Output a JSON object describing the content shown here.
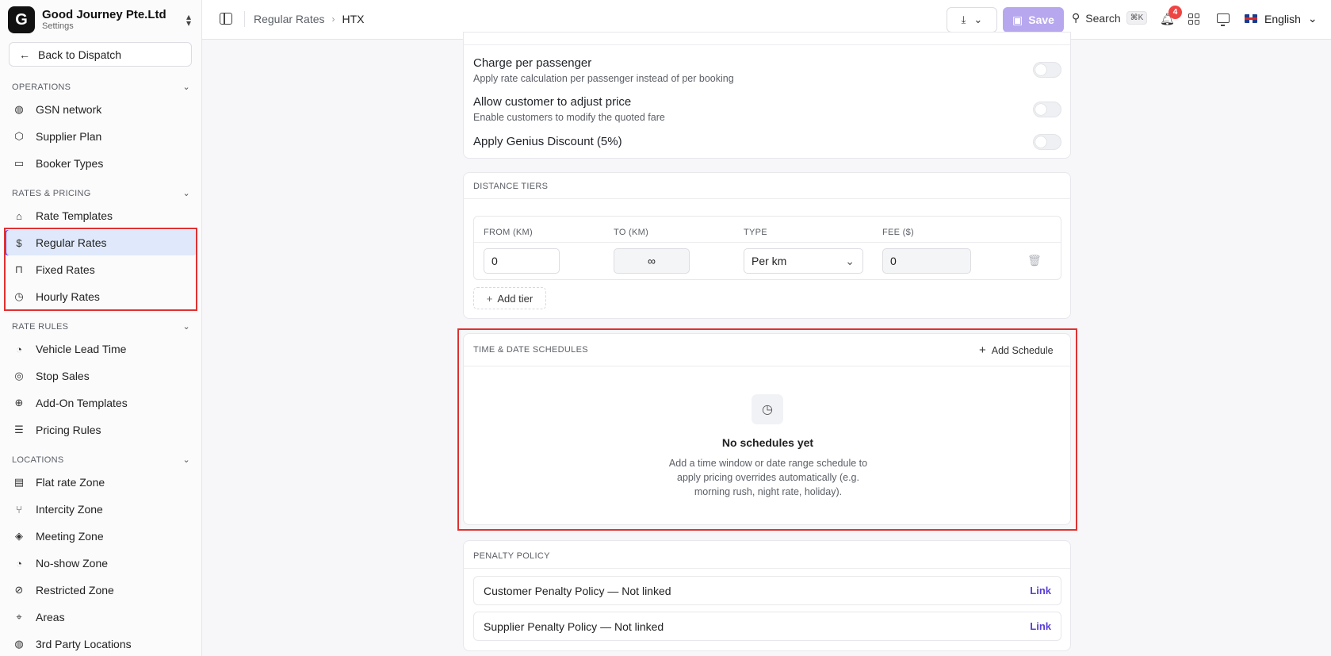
{
  "brand": {
    "name": "Good Journey Pte.Ltd",
    "subtitle": "Settings",
    "logo_letter": "G"
  },
  "back_button": "Back to Dispatch",
  "sidebar": {
    "sections": [
      {
        "title": "OPERATIONS",
        "items": [
          {
            "label": "GSN network",
            "icon": "globe-icon"
          },
          {
            "label": "Supplier Plan",
            "icon": "box-icon"
          },
          {
            "label": "Booker Types",
            "icon": "briefcase-icon"
          }
        ]
      },
      {
        "title": "RATES & PRICING",
        "items": [
          {
            "label": "Rate Templates",
            "icon": "tag-icon"
          },
          {
            "label": "Regular Rates",
            "icon": "dollar-icon",
            "active": true
          },
          {
            "label": "Fixed Rates",
            "icon": "lock-icon"
          },
          {
            "label": "Hourly Rates",
            "icon": "clock-icon"
          }
        ]
      },
      {
        "title": "RATE RULES",
        "items": [
          {
            "label": "Vehicle Lead Time",
            "icon": "timer-icon"
          },
          {
            "label": "Stop Sales",
            "icon": "stop-icon"
          },
          {
            "label": "Add-On Templates",
            "icon": "plus-circle-icon"
          },
          {
            "label": "Pricing Rules",
            "icon": "list-icon"
          }
        ]
      },
      {
        "title": "LOCATIONS",
        "items": [
          {
            "label": "Flat rate Zone",
            "icon": "receipt-icon"
          },
          {
            "label": "Intercity Zone",
            "icon": "route-icon"
          },
          {
            "label": "Meeting Zone",
            "icon": "target-icon"
          },
          {
            "label": "No-show Zone",
            "icon": "timer-icon"
          },
          {
            "label": "Restricted Zone",
            "icon": "ban-icon"
          },
          {
            "label": "Areas",
            "icon": "pin-icon"
          },
          {
            "label": "3rd Party Locations",
            "icon": "globe-icon"
          }
        ]
      }
    ]
  },
  "topbar": {
    "breadcrumb": [
      "Regular Rates",
      "HTX"
    ],
    "save_label": "Save",
    "search_label": "Search",
    "search_shortcut": "⌘K",
    "notification_count": "4",
    "language": "English"
  },
  "options": [
    {
      "title": "Charge per passenger",
      "desc": "Apply rate calculation per passenger instead of per booking",
      "enabled": false
    },
    {
      "title": "Allow customer to adjust price",
      "desc": "Enable customers to modify the quoted fare",
      "enabled": false
    },
    {
      "title": "Apply Genius Discount (5%)",
      "desc": "",
      "enabled": false
    }
  ],
  "distance_tiers": {
    "title": "DISTANCE TIERS",
    "columns": [
      "FROM (KM)",
      "TO (KM)",
      "TYPE",
      "FEE ($)"
    ],
    "rows": [
      {
        "from": "0",
        "to": "∞",
        "type": "Per km",
        "fee": "0"
      }
    ],
    "add_label": "Add tier"
  },
  "schedules": {
    "title": "TIME & DATE SCHEDULES",
    "add_label": "Add Schedule",
    "empty_title": "No schedules yet",
    "empty_desc": "Add a time window or date range schedule to apply pricing overrides automatically (e.g. morning rush, night rate, holiday)."
  },
  "penalty": {
    "title": "PENALTY POLICY",
    "rows": [
      {
        "label": "Customer Penalty Policy — Not linked",
        "link": "Link"
      },
      {
        "label": "Supplier Penalty Policy — Not linked",
        "link": "Link"
      }
    ]
  },
  "colors": {
    "accent": "#6a3df0",
    "highlight": "#e03131",
    "save_bg": "#b7a7ee",
    "active_bg": "#dfe9fb"
  }
}
